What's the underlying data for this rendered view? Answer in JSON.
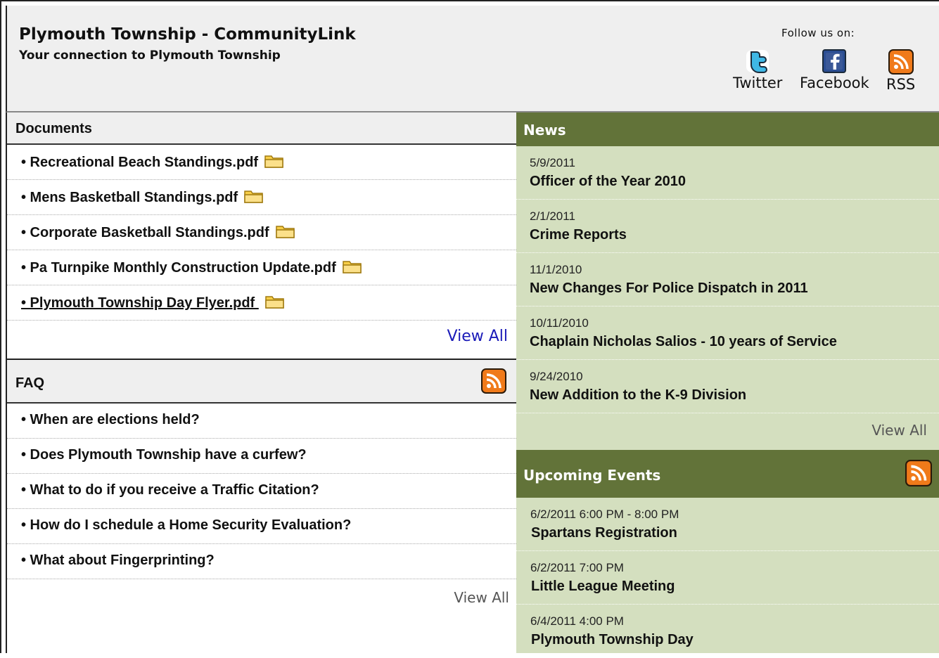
{
  "header": {
    "title": "Plymouth Township - CommunityLink",
    "subtitle": "Your connection to Plymouth Township",
    "follow_label": "Follow us on:",
    "social": [
      {
        "label": "Twitter",
        "icon": "twitter-icon"
      },
      {
        "label": "Facebook",
        "icon": "facebook-icon"
      },
      {
        "label": "RSS",
        "icon": "rss-icon"
      }
    ]
  },
  "documents": {
    "title": "Documents",
    "items": [
      {
        "label": "• Recreational Beach Standings.pdf",
        "icon": "folder-icon"
      },
      {
        "label": "• Mens Basketball Standings.pdf",
        "icon": "folder-icon"
      },
      {
        "label": "• Corporate Basketball Standings.pdf",
        "icon": "folder-icon"
      },
      {
        "label": "• Pa Turnpike Monthly Construction Update.pdf",
        "icon": "folder-icon"
      },
      {
        "label": "• Plymouth Township Day Flyer.pdf ",
        "icon": "folder-icon"
      }
    ],
    "view_all": "View All"
  },
  "faq": {
    "title": "FAQ",
    "items": [
      "• When are elections held?",
      "• Does Plymouth Township have a curfew?",
      "• What to do if you receive a Traffic Citation?",
      "• How do I schedule a Home Security Evaluation?",
      "• What about Fingerprinting?"
    ],
    "view_all": "View All"
  },
  "news": {
    "title": "News",
    "items": [
      {
        "date": "5/9/2011",
        "title": "Officer of the Year 2010"
      },
      {
        "date": "2/1/2011",
        "title": "Crime Reports"
      },
      {
        "date": "11/1/2010",
        "title": "New Changes For Police Dispatch in 2011"
      },
      {
        "date": "10/11/2010",
        "title": "Chaplain Nicholas Salios - 10 years of Service"
      },
      {
        "date": "9/24/2010",
        "title": "New Addition to the K-9 Division"
      }
    ],
    "view_all": "View All"
  },
  "events": {
    "title": "Upcoming Events",
    "items": [
      {
        "date": "6/2/2011 6:00 PM - 8:00 PM",
        "title": "Spartans Registration"
      },
      {
        "date": "6/2/2011 7:00 PM",
        "title": "Little League Meeting"
      },
      {
        "date": "6/4/2011 4:00 PM",
        "title": "Plymouth Township Day"
      }
    ]
  },
  "colors": {
    "green_header": "#627339",
    "green_panel": "#d4dfbf",
    "link_blue": "#1a1ab8",
    "rss_orange": "#f07a1a"
  }
}
